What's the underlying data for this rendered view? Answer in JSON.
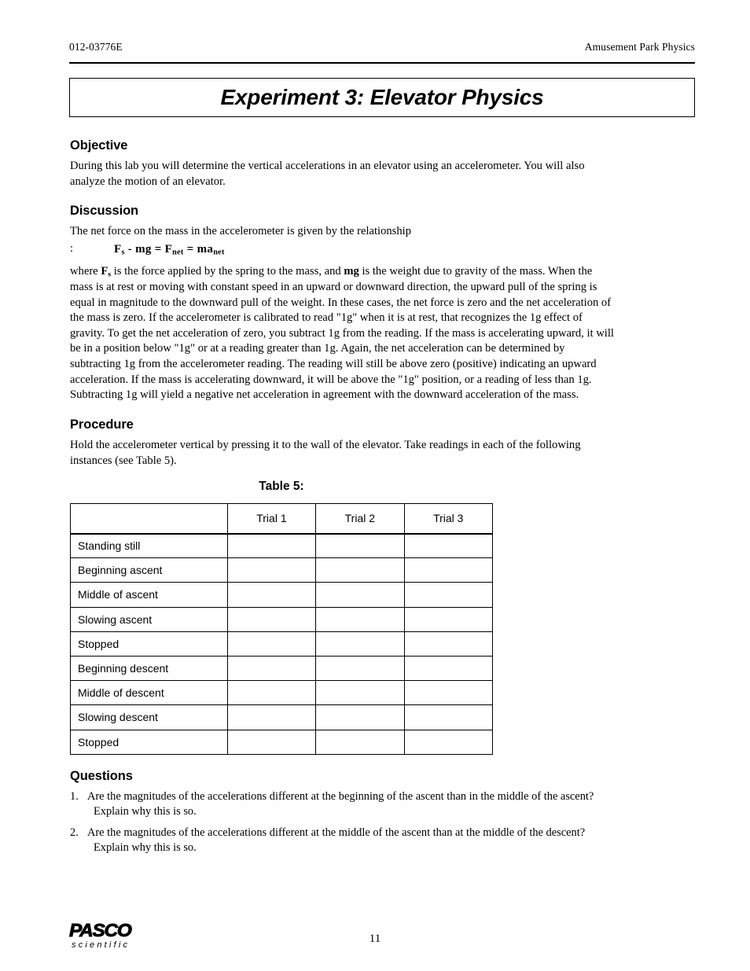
{
  "header": {
    "doc_number": "012-03776E",
    "doc_title": "Amusement Park Physics"
  },
  "title": "Experiment 3: Elevator Physics",
  "sections": {
    "objective": {
      "heading": "Objective",
      "text": "During this lab you will determine the vertical accelerations in an elevator using an accelerometer. You will also analyze the motion of an elevator."
    },
    "discussion": {
      "heading": "Discussion",
      "intro": "The net force on the mass in the accelerometer is given by the relationship",
      "equation_prefix": ":",
      "equation": "Fₛ - mg = Fₙₑₜ = maₙₑₜ",
      "equation_parts": {
        "f": "F",
        "f_sub": "s",
        "minus_mg": " - mg  =  ",
        "fnet": "F",
        "fnet_sub": "net",
        "equals": "  =  ",
        "ma": "ma",
        "ma_sub": "net"
      },
      "body_part1": "where ",
      "body_bold1": "F",
      "body_bold1_sub": "s",
      "body_part2": " is the force applied by the spring to the mass, and ",
      "body_bold2": "mg",
      "body_part3": " is the weight due to gravity of the mass. When the mass is at rest or moving with constant speed in an upward or downward direction, the upward pull of the spring is equal in magnitude to the downward pull of the weight. In these cases, the net force is zero and the net acceleration of the mass is zero. If the accelerometer is calibrated to read \"1g\" when it is at rest, that recognizes the 1g effect of gravity. To get the net acceleration of zero, you subtract 1g from the reading. If the mass is accelerating upward, it will be in a position below \"1g\" or at a reading greater than 1g. Again, the net acceleration can be determined by subtracting 1g from the accelerometer reading. The reading will still be above zero (positive) indicating an upward acceleration. If the mass is accelerating downward, it will be above the \"1g\" position, or a reading of less than 1g. Subtracting 1g will yield a negative net acceleration in agreement with the downward acceleration of the mass."
    },
    "procedure": {
      "heading": "Procedure",
      "text": "Hold the accelerometer vertical by pressing it to the wall of the elevator. Take readings in each of the following instances (see Table 5)."
    },
    "questions": {
      "heading": "Questions",
      "items": [
        {
          "number": "1.",
          "line1": "Are the magnitudes of the accelerations different at the beginning of the ascent than in the middle of the ascent?",
          "line2": "Explain why this is so."
        },
        {
          "number": "2.",
          "line1": "Are the magnitudes of the accelerations different at the middle of the ascent than at the middle of the descent?",
          "line2": "Explain why this is so."
        }
      ]
    }
  },
  "table": {
    "caption": "Table 5:",
    "corner_label": "",
    "columns": [
      "Trial 1",
      "Trial 2",
      "Trial 3"
    ],
    "rows": [
      {
        "label": "Standing still",
        "values": [
          "",
          "",
          ""
        ]
      },
      {
        "label": "Beginning ascent",
        "values": [
          "",
          "",
          ""
        ]
      },
      {
        "label": "Middle of ascent",
        "values": [
          "",
          "",
          ""
        ]
      },
      {
        "label": "Slowing ascent",
        "values": [
          "",
          "",
          ""
        ]
      },
      {
        "label": "Stopped",
        "values": [
          "",
          "",
          ""
        ]
      },
      {
        "label": "Beginning descent",
        "values": [
          "",
          "",
          ""
        ]
      },
      {
        "label": "Middle of descent",
        "values": [
          "",
          "",
          ""
        ]
      },
      {
        "label": "Slowing descent",
        "values": [
          "",
          "",
          ""
        ]
      },
      {
        "label": "Stopped",
        "values": [
          "",
          "",
          ""
        ]
      }
    ]
  },
  "footer": {
    "logo_main": "PASCO",
    "logo_sub": "scientific",
    "page_number": "11"
  }
}
